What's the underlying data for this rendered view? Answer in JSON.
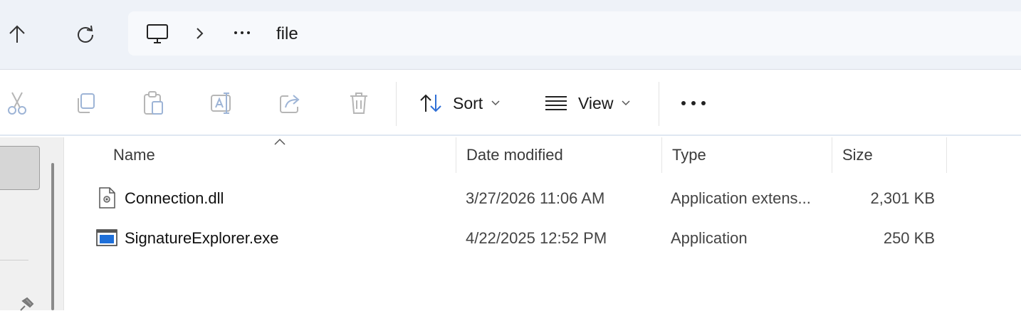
{
  "address_bar": {
    "up_icon": "arrow-up-icon",
    "refresh_icon": "refresh-icon",
    "location_icon": "this-pc-icon",
    "separator_icon": "chevron-right-icon",
    "overflow_icon": "ellipsis-icon",
    "overflow_label": "···",
    "current_folder": "file"
  },
  "toolbar": {
    "icons": [
      "cut-icon",
      "copy-icon",
      "paste-icon",
      "rename-icon",
      "share-icon",
      "delete-icon"
    ],
    "sort_label": "Sort",
    "view_label": "View",
    "more_label": "•••"
  },
  "file_list": {
    "columns": [
      "Name",
      "Date modified",
      "Type",
      "Size"
    ],
    "sorted_by": "Name",
    "rows": [
      {
        "name": "Connection.dll",
        "icon": "dll-file-icon",
        "date": "3/27/2026 11:06 AM",
        "type": "Application extens...",
        "size": "2,301 KB"
      },
      {
        "name": "SignatureExplorer.exe",
        "icon": "exe-file-icon",
        "date": "4/22/2025 12:52 PM",
        "type": "Application",
        "size": "250 KB"
      }
    ]
  },
  "colors": {
    "address_bar_bg": "#eef2f8",
    "accent": "#2f6fd6",
    "nav_pane_bg": "#f0f0f0"
  }
}
